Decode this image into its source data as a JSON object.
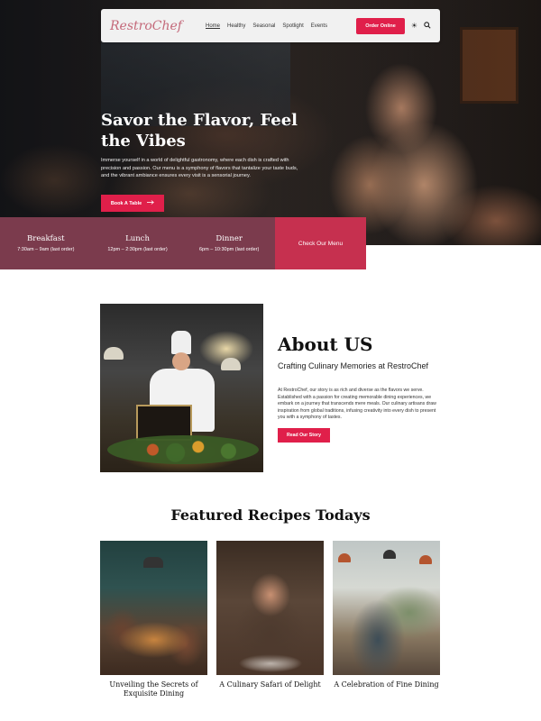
{
  "nav": {
    "logo": "RestroChef",
    "items": [
      {
        "label": "Home",
        "active": true
      },
      {
        "label": "Healthy"
      },
      {
        "label": "Seasonal"
      },
      {
        "label": "Spotlight"
      },
      {
        "label": "Events"
      }
    ],
    "order_button": "Order Online",
    "icons": [
      "theme-toggle-icon",
      "search-icon"
    ]
  },
  "hero": {
    "title": "Savor the Flavor, Feel the Vibes",
    "text": "Immerse yourself in a world of delightful gastronomy, where each dish is crafted with precision and passion. Our menu is a symphony of flavors that tantalize your taste buds, and the vibrant ambiance ensures every visit is a sensorial journey.",
    "button": "Book A Table",
    "button_icon": "arrow-right-icon"
  },
  "hours": [
    {
      "name": "Breakfast",
      "time": "7:30am – 9am (last order)"
    },
    {
      "name": "Lunch",
      "time": "12pm – 2:30pm (last order)"
    },
    {
      "name": "Dinner",
      "time": "6pm – 10:30pm (last order)"
    }
  ],
  "menu_cta": "Check Our Menu",
  "about": {
    "title": "About US",
    "subtitle": "Crafting Culinary Memories at RestroChef",
    "text": "At RestroChef, our story is as rich and diverse as the flavors we serve. Established with a passion for creating memorable dining experiences, we embark on a journey that transcends mere meals. Our culinary artisans draw inspiration from global traditions, infusing creativity into every dish to present you with a symphony of tastes.",
    "button": "Read Our Story"
  },
  "featured": {
    "title": "Featured Recipes Todays",
    "cards": [
      {
        "caption": "Unveiling the Secrets of Exquisite Dining"
      },
      {
        "caption": "A Culinary Safari of Delight"
      },
      {
        "caption": "A Celebration of Fine Dining"
      }
    ]
  },
  "colors": {
    "accent": "#e01f4a",
    "hours_bg": "#7b3b4d",
    "menu_cta_bg": "#c6304f"
  }
}
